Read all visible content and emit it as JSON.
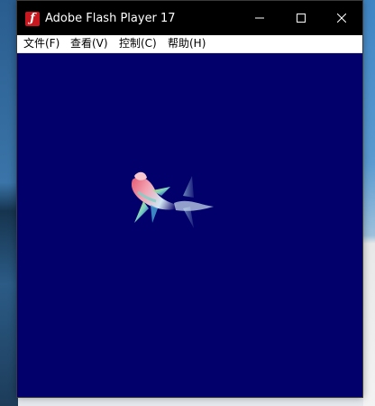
{
  "window": {
    "title": "Adobe Flash Player 17"
  },
  "menu": {
    "items": [
      "文件(F)",
      "查看(V)",
      "控制(C)",
      "帮助(H)"
    ]
  },
  "colors": {
    "stage": "#02006b",
    "titlebar": "#000000",
    "menubar": "#ffffff",
    "app_icon": "#c8171e"
  },
  "icons": {
    "app": "flash-player-icon",
    "minimize": "minimize-icon",
    "maximize": "maximize-icon",
    "close": "close-icon",
    "stage_graphic": "koi-fish-graphic"
  }
}
